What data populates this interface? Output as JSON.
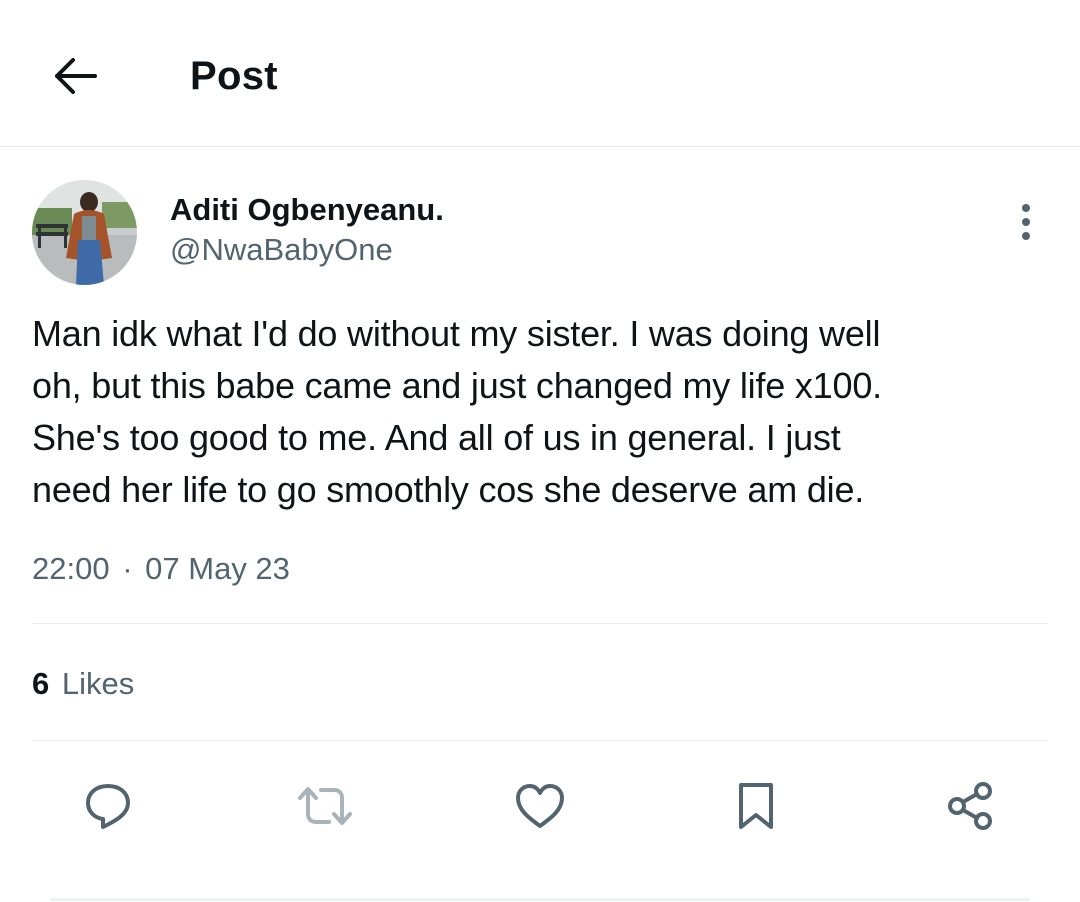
{
  "header": {
    "title": "Post",
    "back_icon": "arrow-left-icon"
  },
  "author": {
    "name": "Aditi Ogbenyeanu.",
    "handle": "@NwaBabyOne",
    "more_icon": "more-vertical-icon"
  },
  "tweet": {
    "lines": [
      "Man idk what I'd do without my sister. I was doing well",
      "oh, but this babe came and just changed my life x100.",
      "She's too good to me. And all of us in general. I just",
      "need her life to go smoothly cos she deserve am die."
    ],
    "time": "22:00",
    "separator": "·",
    "date": "07 May 23"
  },
  "stats": {
    "likes_count": "6",
    "likes_label": "Likes"
  },
  "actions": [
    {
      "icon": "reply-icon"
    },
    {
      "icon": "retweet-icon"
    },
    {
      "icon": "like-heart-icon"
    },
    {
      "icon": "bookmark-icon"
    },
    {
      "icon": "share-icon"
    }
  ],
  "colors": {
    "text_primary": "#0f1419",
    "text_secondary": "#536471",
    "divider": "#e6e9ec",
    "icon": "#536471",
    "retweet_icon_disabled": "#a8b3ba"
  }
}
